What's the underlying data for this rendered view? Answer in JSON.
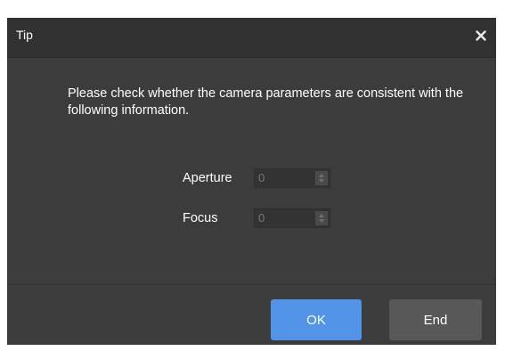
{
  "dialog": {
    "title": "Tip",
    "close_icon": "close-icon",
    "message": "Please check whether the camera parameters are consistent with the following information.",
    "fields": {
      "aperture": {
        "label": "Aperture",
        "value": "0"
      },
      "focus": {
        "label": "Focus",
        "value": "0"
      }
    },
    "buttons": {
      "ok_label": "OK",
      "end_label": "End"
    }
  },
  "colors": {
    "dialog_bg": "#3c3c3c",
    "titlebar_bg": "#313131",
    "ok_button": "#5294e8",
    "end_button": "#585858"
  }
}
